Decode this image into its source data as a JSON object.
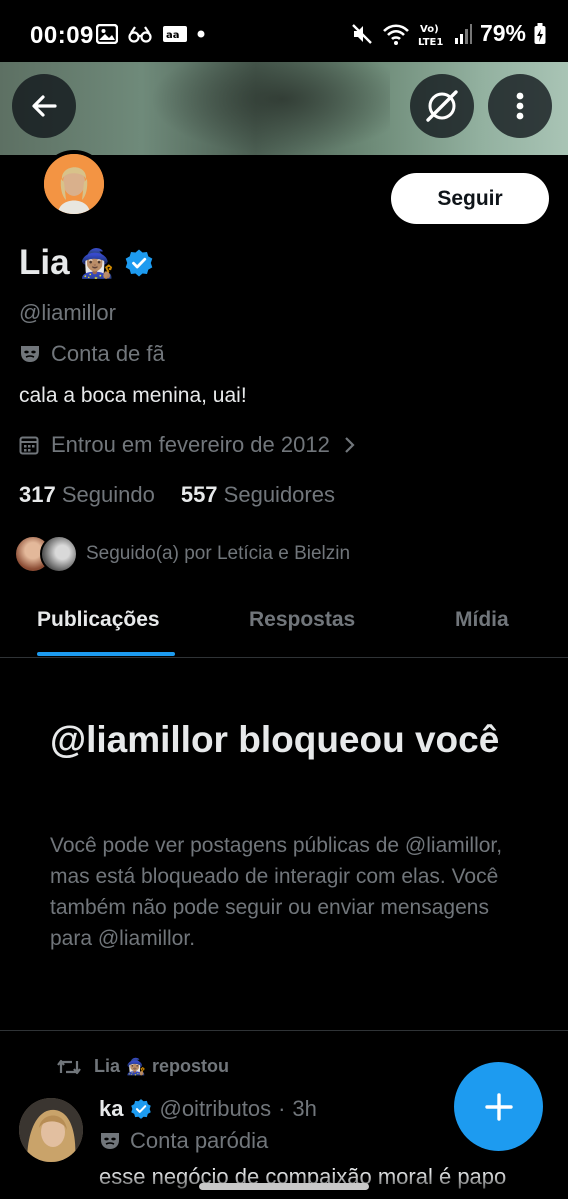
{
  "status_bar": {
    "time": "00:09",
    "battery": "79%",
    "network": "LTE1"
  },
  "header": {
    "back_icon": "arrow-left-icon",
    "grok_icon": "grok-slash-icon",
    "more_icon": "more-vertical-icon"
  },
  "profile": {
    "name": "Lia",
    "name_emoji": "🧙🏽‍♀️",
    "handle": "@liamillor",
    "label": "Conta de fã",
    "bio": "cala a boca menina, uai!",
    "joined": "Entrou em fevereiro de 2012",
    "following_count": "317",
    "following_label": "Seguindo",
    "followers_count": "557",
    "followers_label": "Seguidores",
    "followed_by": "Seguido(a) por Letícia e Bielzin",
    "follow_button": "Seguir"
  },
  "tabs": [
    {
      "label": "Publicações",
      "active": true
    },
    {
      "label": "Respostas",
      "active": false
    },
    {
      "label": "Mídia",
      "active": false
    }
  ],
  "blocked": {
    "title": "@liamillor bloqueou você",
    "description": "Você pode ver postagens públicas de @liamillor, mas está bloqueado de interagir com elas. Você também não pode seguir ou enviar mensagens para @liamillor."
  },
  "tweet": {
    "repost_name": "Lia",
    "repost_emoji": "🧙🏽‍♀️",
    "repost_suffix": "repostou",
    "author_name": "ka",
    "author_handle": "@oitributos",
    "separator": "·",
    "time": "3h",
    "label": "Conta paródia",
    "text": "esse negócio de compaixão moral é papo"
  },
  "colors": {
    "accent": "#1d9bf0",
    "background": "#000000",
    "text_primary": "#e7e9ea",
    "text_secondary": "#71767b",
    "divider": "#2f3336"
  }
}
